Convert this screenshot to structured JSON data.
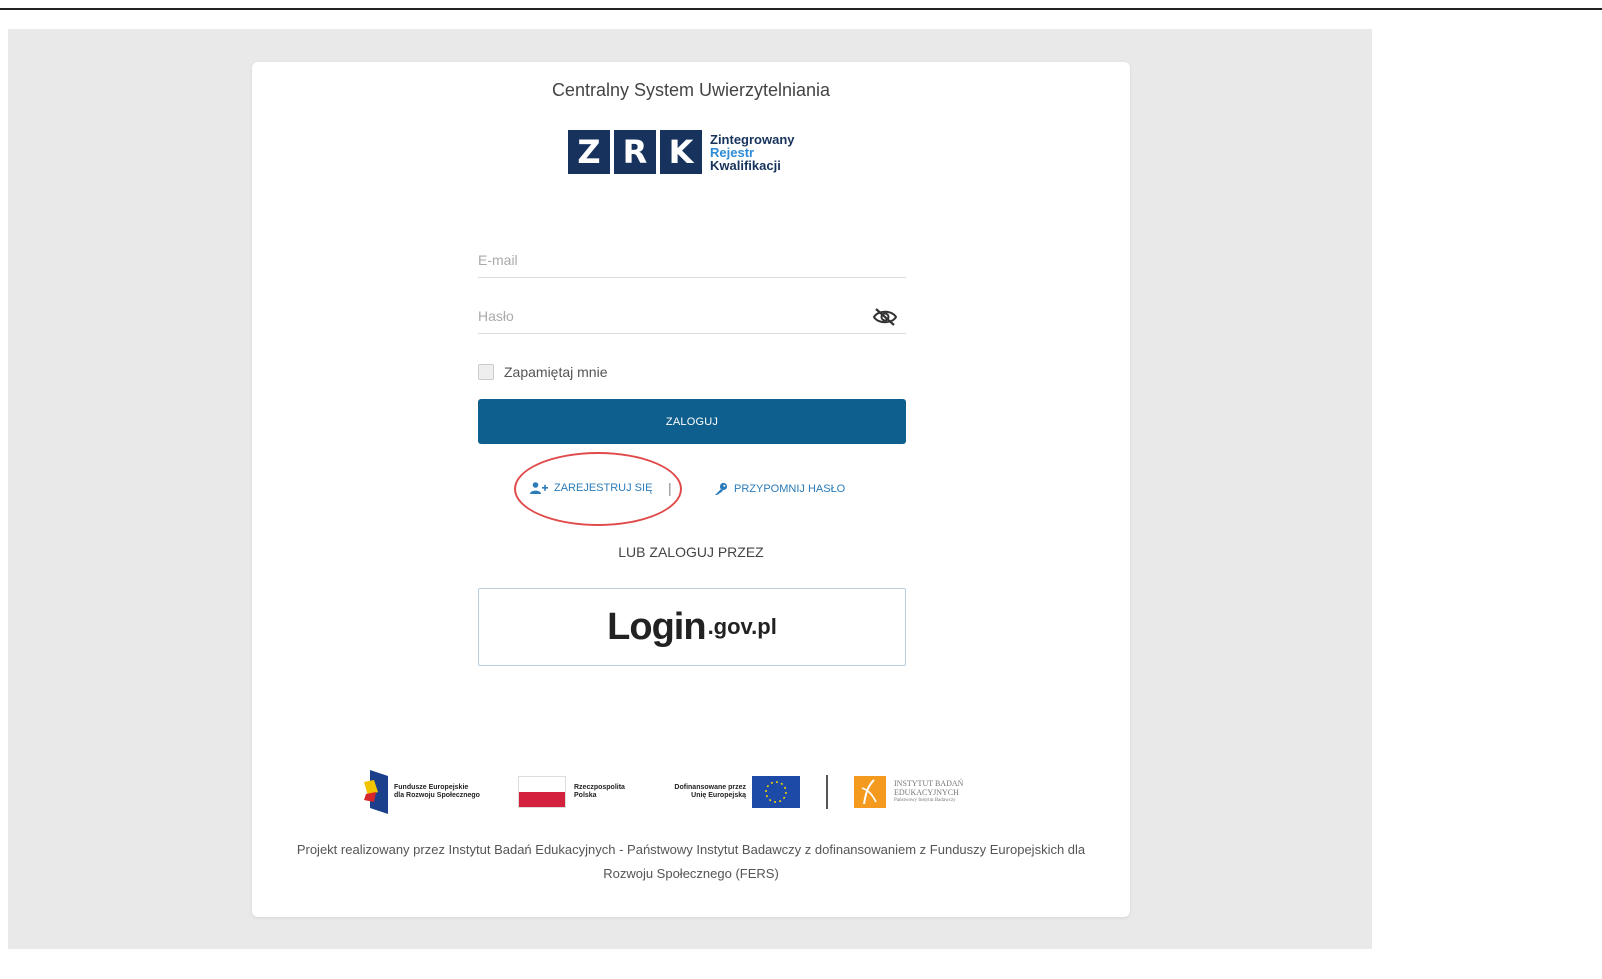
{
  "header": {
    "title": "Centralny System Uwierzytelniania"
  },
  "logo": {
    "letters": [
      "Z",
      "R",
      "K"
    ],
    "line1": "Zintegrowany",
    "line2": "Rejestr",
    "line3": "Kwalifikacji"
  },
  "form": {
    "email_placeholder": "E-mail",
    "password_placeholder": "Hasło",
    "remember_label": "Zapamiętaj mnie",
    "login_button": "ZALOGUJ"
  },
  "links": {
    "register": "ZAREJESTRUJ SIĘ",
    "separator": "|",
    "remind": "PRZYPOMNIJ HASŁO"
  },
  "alt_login": {
    "label": "LUB ZALOGUJ PRZEZ",
    "gov_main": "Login",
    "gov_sub": ".gov.pl"
  },
  "funding": {
    "fe_line1": "Fundusze Europejskie",
    "fe_line2": "dla Rozwoju Społecznego",
    "rp_line1": "Rzeczpospolita",
    "rp_line2": "Polska",
    "ue_line1": "Dofinansowane przez",
    "ue_line2": "Unię Europejską",
    "ibe_line1": "INSTYTUT BADAŃ",
    "ibe_line2": "EDUKACYJNYCH",
    "ibe_line3": "Państwowy Instytut Badawczy"
  },
  "footer": {
    "text": "Projekt realizowany przez Instytut Badań Edukacyjnych - Państwowy Instytut Badawczy z dofinansowaniem z Funduszy Europejskich dla Rozwoju Społecznego (FERS)"
  },
  "colors": {
    "primary": "#0f5f8e",
    "link": "#2b7bb9",
    "logo_navy": "#17325c",
    "annotation": "#e04a4a"
  }
}
